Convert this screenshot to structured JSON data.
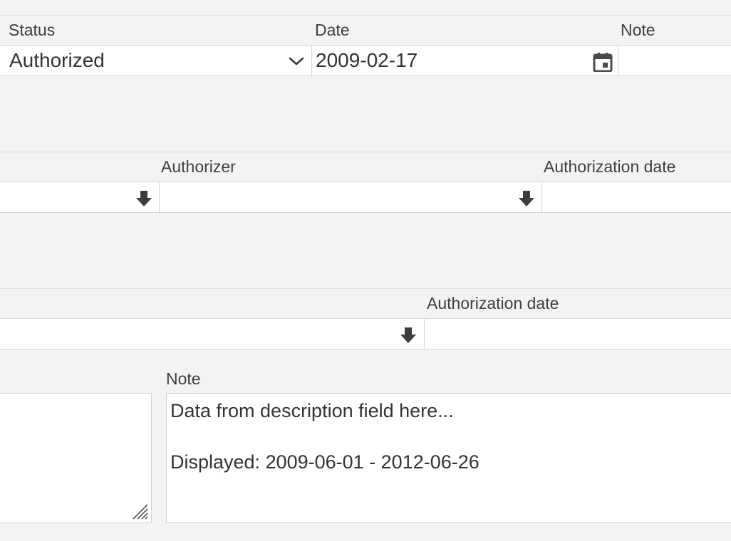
{
  "row1": {
    "status_label": "Status",
    "status_value": "Authorized",
    "date_label": "Date",
    "date_value": "2009-02-17",
    "note_label": "Note"
  },
  "row2": {
    "authorizer_label": "Authorizer",
    "authorization_date_label": "Authorization date"
  },
  "row3": {
    "authorization_date_label": "Authorization date"
  },
  "row4": {
    "note_label": "Note",
    "note_value": "Data from description field here...\n\nDisplayed: 2009-06-01 - 2012-06-26"
  },
  "icons": {
    "status_dropdown": "chevron-down-icon",
    "date_picker": "calendar-icon",
    "lookup": "arrow-down-icon"
  }
}
